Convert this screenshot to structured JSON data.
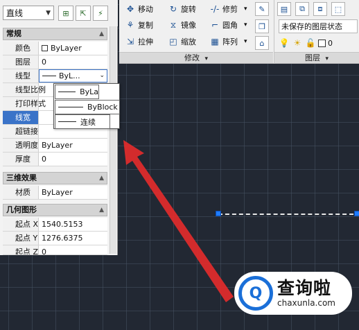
{
  "ribbon": {
    "modify": {
      "move": "移动",
      "rotate": "旋转",
      "trim": "修剪",
      "copy": "复制",
      "mirror": "镜像",
      "fillet": "圆角",
      "stretch": "拉伸",
      "scale": "缩放",
      "array": "阵列",
      "panel_label": "修改",
      "dropdown_glyph": "▾"
    },
    "layers": {
      "state": "未保存的图层状态",
      "current_layer_value": "0",
      "panel_label": "图层"
    }
  },
  "properties": {
    "object_type": "直线",
    "sections": {
      "general": {
        "title": "常规",
        "rows": [
          {
            "label": "颜色",
            "value": "ByLayer"
          },
          {
            "label": "图层",
            "value": "0"
          },
          {
            "label": "线型",
            "value": "ByL..."
          },
          {
            "label": "线型比例",
            "value": ""
          },
          {
            "label": "打印样式",
            "value": ""
          },
          {
            "label": "线宽",
            "value": ""
          },
          {
            "label": "超链接",
            "value": ""
          },
          {
            "label": "透明度",
            "value": "ByLayer"
          },
          {
            "label": "厚度",
            "value": "0"
          }
        ]
      },
      "three_d": {
        "title": "三维效果",
        "rows": [
          {
            "label": "材质",
            "value": "ByLayer"
          }
        ]
      },
      "geometry": {
        "title": "几何图形",
        "rows": [
          {
            "label": "起点 X",
            "value": "1540.5153"
          },
          {
            "label": "起点 Y",
            "value": "1276.6375"
          },
          {
            "label": "起点 Z",
            "value": "0"
          }
        ]
      }
    },
    "linetype_dropdown": [
      "ByLa",
      "ByBlock",
      "连续"
    ]
  },
  "watermark": {
    "brand": "查询啦",
    "url": "chaxunla.com"
  },
  "colors": {
    "canvas": "#222833",
    "accent_blue": "#1e7cff",
    "arrow_red": "#e32b2b",
    "highlight": "#3a73c8"
  }
}
